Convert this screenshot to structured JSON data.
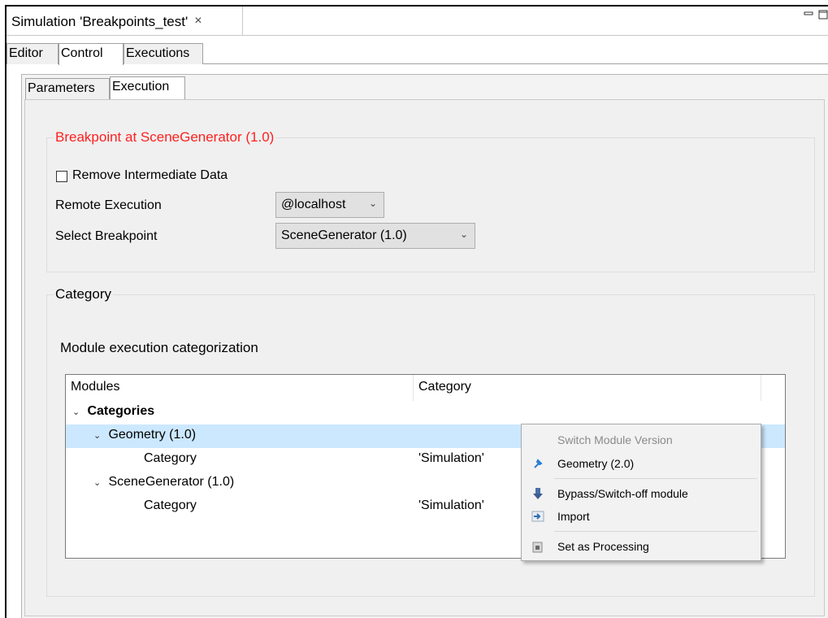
{
  "editor_tab": {
    "title": "Simulation 'Breakpoints_test'",
    "close": "×"
  },
  "sub_tabs": [
    "Editor",
    "Control",
    "Executions"
  ],
  "inner_tabs": [
    "Parameters",
    "Execution"
  ],
  "breakpoint_group": {
    "title": "Breakpoint at SceneGenerator (1.0)",
    "title_color": "#ff1f1f",
    "remove_data_label": "Remove Intermediate Data",
    "remote_label": "Remote Execution",
    "remote_value": "@localhost",
    "select_label": "Select Breakpoint",
    "select_value": "SceneGenerator (1.0)"
  },
  "category_group": {
    "title": "Category",
    "subtitle": "Module execution categorization",
    "columns": [
      "Modules",
      "Category"
    ],
    "rows": [
      {
        "module": "Categories",
        "category": ""
      },
      {
        "module": "Geometry (1.0)",
        "category": ""
      },
      {
        "module": "Category",
        "category": "'Simulation'"
      },
      {
        "module": "SceneGenerator (1.0)",
        "category": ""
      },
      {
        "module": "Category",
        "category": "'Simulation'"
      }
    ]
  },
  "context_menu": {
    "items": [
      {
        "label": "Switch Module Version",
        "icon": "",
        "disabled": true
      },
      {
        "label": "Geometry (2.0)",
        "icon": "pin-icon"
      },
      {
        "label": "Bypass/Switch-off module",
        "icon": "bypass-icon"
      },
      {
        "label": "Import",
        "icon": "import-icon"
      },
      {
        "label": "Set as Processing",
        "icon": "processing-icon"
      }
    ]
  },
  "colors": {
    "selection": "#cce8ff",
    "accent": "#0078d7"
  }
}
